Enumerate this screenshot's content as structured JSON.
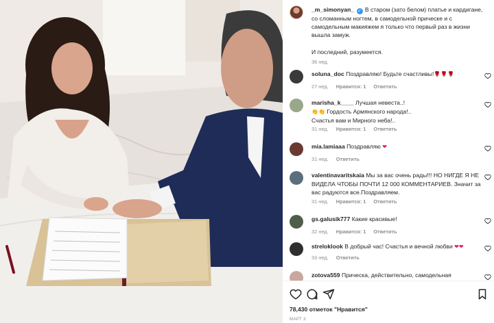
{
  "post": {
    "username": "_m_simonyan_",
    "caption": "В старом (зато белом) платье и кардигане, со сломанным ногтем, в самодельной прическе и с самодельным макияжем я только что первый раз в жизни вышла замуж.",
    "caption_second": "И последний, разумеется.",
    "time": "36 нед."
  },
  "comments": [
    {
      "user": "soluna_doc",
      "text": "Поздравляю! Будьте счастливы!",
      "emoji": "🌹🌹🌹",
      "time": "27 нед.",
      "likes": "Нравится: 1",
      "reply": "Ответить",
      "avatar_color": "#3a3a3a"
    },
    {
      "user": "marisha_k____",
      "text": "Лучшая невеста..!",
      "line2": "Гордость Армянского народа!..",
      "line3": "Счастья вам и Мирного неба!..",
      "emoji_line2": "👏👏",
      "time": "31 нед.",
      "likes": "Нравится: 1",
      "reply": "Ответить",
      "avatar_color": "#9aa88a"
    },
    {
      "user": "mia.lamiaaa",
      "text": "Поздравляю",
      "emoji": "❤",
      "time": "31 нед.",
      "reply": "Ответить",
      "avatar_color": "#6a3a32"
    },
    {
      "user": "valentinavaritskaia",
      "text": "Мы за вас очень рады!!! НО НИГДЕ Я НЕ ВИДЕЛА ЧТОБЫ ПОЧТИ 12 000 КОММЕНТАРИЕВ. Значит за вас радуются все.Поздравляем.",
      "time": "31 нед.",
      "likes": "Нравится: 1",
      "reply": "Ответить",
      "avatar_color": "#5a6f7d"
    },
    {
      "user": "gs.galusik777",
      "text": "Какие красивые!",
      "time": "32 нед.",
      "likes": "Нравится: 1",
      "reply": "Ответить",
      "avatar_color": "#4f5e4a"
    },
    {
      "user": "streloklook",
      "text": "В добрый час! Счастья и вечной любви",
      "emoji": "❤❤",
      "time": "33 нед.",
      "reply": "Ответить",
      "avatar_color": "#2f2f2f"
    },
    {
      "user": "zotova559",
      "text": "Прическа, действительно, самодельная",
      "avatar_color": "#c9a6a0"
    }
  ],
  "footer": {
    "likes_count": "78,430",
    "likes_suffix": "отметок \"Нравится\"",
    "date": "МАРТ 3"
  },
  "icons": [
    "heart-icon",
    "comment-icon",
    "share-icon",
    "bookmark-icon",
    "verified-badge"
  ],
  "colors": {
    "accent": "#3897f0",
    "like_red": "#e0245e",
    "muted": "#8e8e8e"
  }
}
